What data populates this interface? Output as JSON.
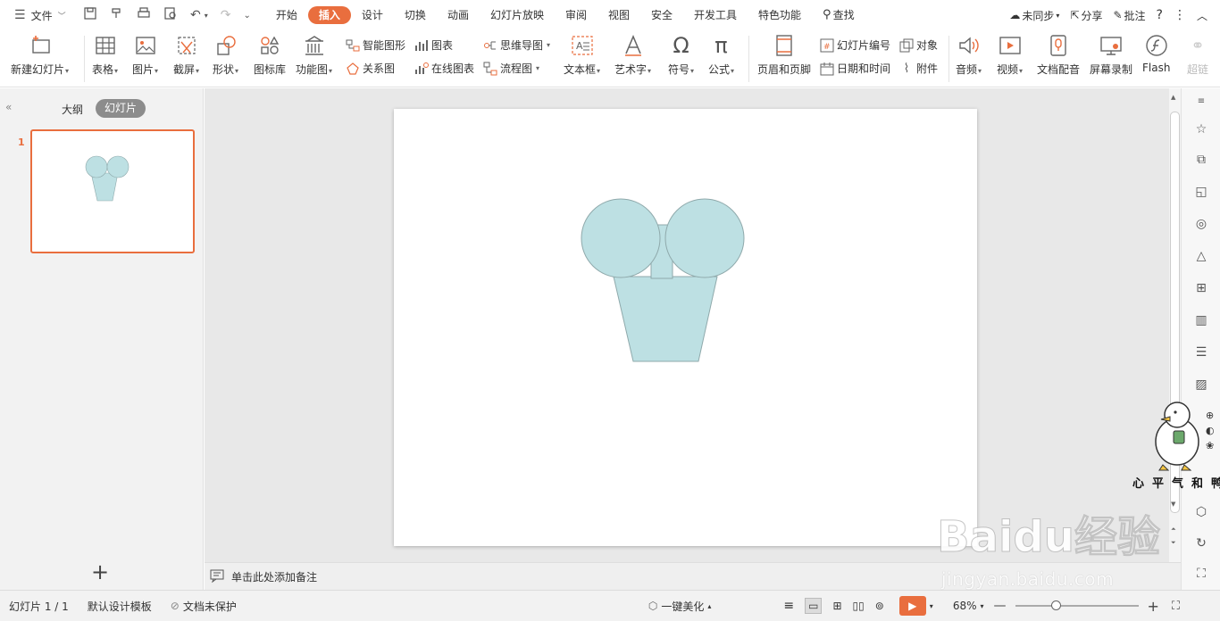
{
  "menubar": {
    "file_label": "文件",
    "tabs": [
      "开始",
      "插入",
      "设计",
      "切换",
      "动画",
      "幻灯片放映",
      "审阅",
      "视图",
      "安全",
      "开发工具",
      "特色功能"
    ],
    "active_tab": "插入",
    "search_label": "查找",
    "sync_label": "未同步",
    "share_label": "分享",
    "comment_label": "批注"
  },
  "ribbon": {
    "new_slide": "新建幻灯片",
    "table": "表格",
    "picture": "图片",
    "screenshot": "截屏",
    "shape": "形状",
    "icon_library": "图标库",
    "function_chart": "功能图",
    "smart_art": "智能图形",
    "chart": "图表",
    "mind_map": "思维导图",
    "relation": "关系图",
    "online_chart": "在线图表",
    "flowchart": "流程图",
    "text_box": "文本框",
    "word_art": "艺术字",
    "symbol": "符号",
    "formula": "公式",
    "header_footer": "页眉和页脚",
    "slide_number": "幻灯片编号",
    "object": "对象",
    "date_time": "日期和时间",
    "attachment": "附件",
    "audio": "音频",
    "video": "视频",
    "doc_voice": "文档配音",
    "screen_record": "屏幕录制",
    "flash": "Flash",
    "hyperlink": "超链"
  },
  "leftpanel": {
    "outline_tab": "大纲",
    "slides_tab": "幻灯片",
    "slide_number": "1",
    "add_slide": "+"
  },
  "notes": {
    "placeholder": "单击此处添加备注"
  },
  "statusbar": {
    "slide_info": "幻灯片 1 / 1",
    "template": "默认设计模板",
    "protection": "文档未保护",
    "beautify": "一键美化",
    "zoom": "68%"
  },
  "watermark": {
    "brand": "Baidu经验",
    "url": "jingyan.baidu.com"
  },
  "mascot": {
    "caption": "心平气和鸭"
  },
  "colors": {
    "accent": "#e96e3e",
    "shape_fill": "#bde0e3",
    "shape_stroke": "#8fa9ab"
  }
}
